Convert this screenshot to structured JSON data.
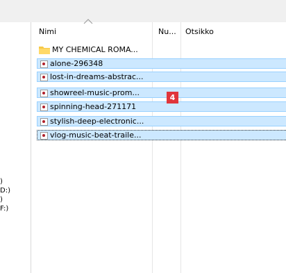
{
  "left_pane": {
    "drives": [
      ")",
      "D:)",
      ")",
      "F:)"
    ]
  },
  "columns": {
    "name": "Nimi",
    "number": "Nu...",
    "title": "Otsikko"
  },
  "items": [
    {
      "name": "MY CHEMICAL ROMA...",
      "type": "folder",
      "selected": false
    },
    {
      "name": "alone-296348",
      "type": "audio",
      "selected": true
    },
    {
      "name": "lost-in-dreams-abstrac...",
      "type": "audio",
      "selected": true
    },
    {
      "name": "showreel-music-prom...",
      "type": "audio",
      "selected": true
    },
    {
      "name": "spinning-head-271171",
      "type": "audio",
      "selected": true
    },
    {
      "name": "stylish-deep-electronic...",
      "type": "audio",
      "selected": true
    },
    {
      "name": "vlog-music-beat-traile...",
      "type": "audio",
      "selected": true
    }
  ],
  "badge": "4",
  "colors": {
    "selection": "#cce8ff",
    "selection_border": "#99d1ff",
    "badge": "#e0353b",
    "folder": "#f7c948"
  }
}
